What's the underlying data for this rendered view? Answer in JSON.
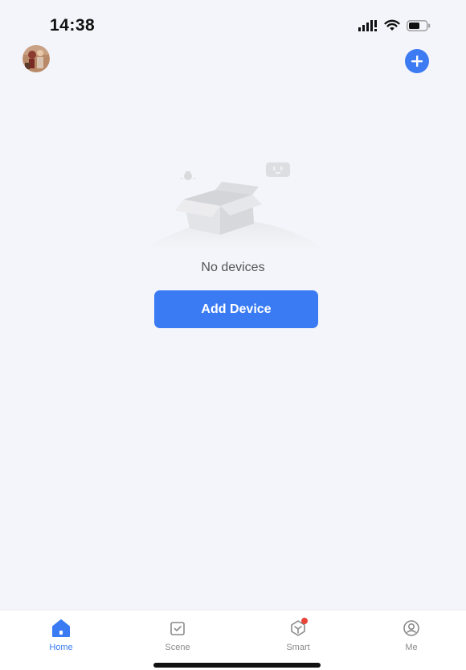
{
  "status_bar": {
    "time": "14:38"
  },
  "header": {
    "avatar_icon": "user-avatar",
    "add_icon": "plus-circle-icon"
  },
  "empty_state": {
    "message": "No devices",
    "add_button_label": "Add Device",
    "illustration_icon": "empty-box-illustration"
  },
  "tabs": [
    {
      "label": "Home",
      "icon": "home-icon",
      "active": true
    },
    {
      "label": "Scene",
      "icon": "scene-icon",
      "active": false
    },
    {
      "label": "Smart",
      "icon": "smart-icon",
      "active": false
    },
    {
      "label": "Me",
      "icon": "me-icon",
      "active": false
    }
  ],
  "colors": {
    "accent": "#3a7bf3",
    "background": "#f4f5fa",
    "tab_inactive": "#8a8a8a",
    "badge": "#e8443a"
  }
}
